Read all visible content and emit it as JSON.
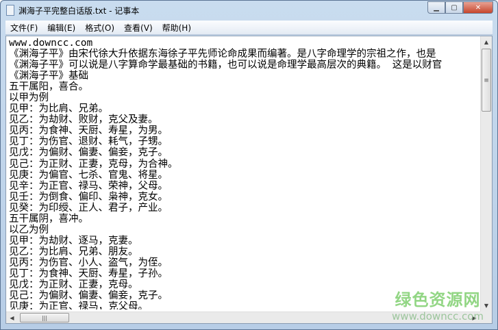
{
  "window": {
    "title": "渊海子平完整白话版.txt - 记事本",
    "icon": "notepad-icon",
    "controls": [
      "minimize",
      "maximize",
      "close"
    ]
  },
  "menu": [
    "文件(F)",
    "编辑(E)",
    "格式(O)",
    "查看(V)",
    "帮助(H)"
  ],
  "lines": [
    "www.downcc.com",
    "《渊海子平》由宋代徐大升依据东海徐子平先师论命成果而编著。是八字命理学的宗祖之作，也是",
    "《渊海子平》可以说是八字算命学最基础的书籍，也可以说是命理学最高层次的典籍。 这是以财官",
    "《渊海子平》基础",
    "五干属阳，喜合。",
    "以甲为例",
    "见甲：为比肩、兄弟。",
    "见乙：为劫财、败财，克父及妻。",
    "见丙：为食神、天厨、寿星，为男。",
    "见丁：为伤官、退财、耗气，子甥。",
    "见戊：为偏财、偏妻、偏妾，克子。",
    "见己：为正财、正妻，克母，为合神。",
    "见庚：为偏官、七杀、官鬼、将星。",
    "见辛：为正官、禄马、荣神，父母。",
    "见壬：为倒食、偏印、枭神，克女。",
    "见癸：为印绶、正人、君子，产业。",
    "五干属阴，喜冲。",
    "以乙为例",
    "见甲：为劫财、逐马，克妻。",
    "见乙：为比肩、兄弟、朋友。",
    "见丙：为伤官、小人、盗气，为侄。",
    "见丁：为食神、天厨、寿星，子孙。",
    "见戊：为正财、正妻，克母。",
    "见己：为偏财、偏妻、偏妾，克子。",
    "见庚：为正官、禄马，克父母。"
  ],
  "watermark": {
    "cn": "绿色资源网",
    "url": "www.downcc.com"
  }
}
